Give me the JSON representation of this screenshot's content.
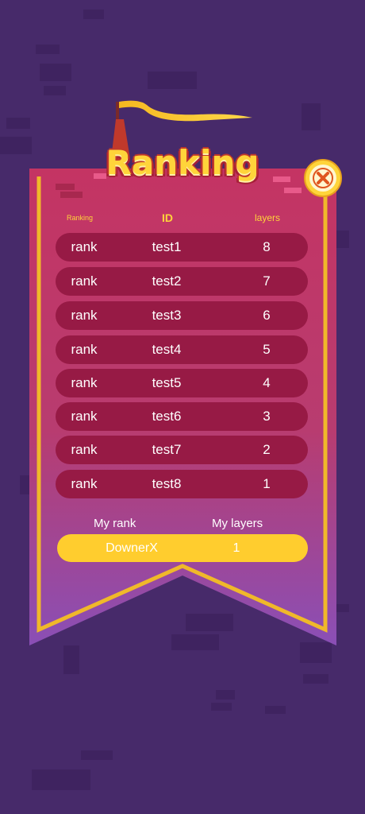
{
  "title": "Ranking",
  "headers": {
    "rank": "Ranking",
    "id": "ID",
    "layers": "layers"
  },
  "rows": [
    {
      "rank": "rank",
      "id": "test1",
      "layers": "8"
    },
    {
      "rank": "rank",
      "id": "test2",
      "layers": "7"
    },
    {
      "rank": "rank",
      "id": "test3",
      "layers": "6"
    },
    {
      "rank": "rank",
      "id": "test4",
      "layers": "5"
    },
    {
      "rank": "rank",
      "id": "test5",
      "layers": "4"
    },
    {
      "rank": "rank",
      "id": "test6",
      "layers": "3"
    },
    {
      "rank": "rank",
      "id": "test7",
      "layers": "2"
    },
    {
      "rank": "rank",
      "id": "test8",
      "layers": "1"
    }
  ],
  "my": {
    "rank_label": "My rank",
    "layers_label": "My layers",
    "name": "DownerX",
    "layers": "1"
  },
  "colors": {
    "background": "#472a6a",
    "row": "#971a45",
    "accent": "#ffd43a",
    "my_row": "#ffcd2e"
  }
}
